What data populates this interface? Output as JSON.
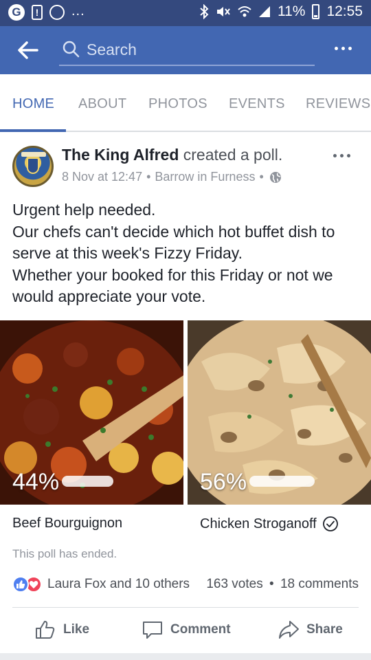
{
  "status_bar": {
    "left_icons": [
      "g-notification-icon",
      "alert-icon",
      "circle-icon",
      "more-notifications-icon"
    ],
    "more_text": "...",
    "battery": "11%",
    "time": "12:55",
    "right_icons": [
      "bluetooth-icon",
      "mute-icon",
      "wifi-icon",
      "signal-icon",
      "battery-icon"
    ]
  },
  "app_bar": {
    "search_placeholder": "Search",
    "back_icon": "back-arrow-icon",
    "more_icon": "more-horizontal-icon"
  },
  "tabs": [
    {
      "label": "HOME",
      "active": true
    },
    {
      "label": "ABOUT",
      "active": false
    },
    {
      "label": "PHOTOS",
      "active": false
    },
    {
      "label": "EVENTS",
      "active": false
    },
    {
      "label": "REVIEWS",
      "active": false
    }
  ],
  "post": {
    "author": "The King Alfred",
    "action": "created a poll.",
    "date": "8 Nov at 12:47",
    "location": "Barrow in Furness",
    "separator": "•",
    "text_lines": [
      "Urgent help needed.",
      "Our chefs can't decide which hot buffet dish to",
      "serve at this week's Fizzy Friday.",
      "Whether your booked for this Friday or not we",
      "would appreciate your vote."
    ]
  },
  "poll": {
    "options": [
      {
        "label": "Beef Bourguignon",
        "percent_text": "44%",
        "percent": 44,
        "winner": false
      },
      {
        "label": "Chicken Stroganoff",
        "percent_text": "56%",
        "percent": 56,
        "winner": true
      }
    ],
    "status": "This poll has ended."
  },
  "engagement": {
    "reactions": [
      "like-reaction-icon",
      "love-reaction-icon"
    ],
    "reactors": "Laura Fox and 10 others",
    "votes": "163 votes",
    "separator": "•",
    "comments": "18 comments"
  },
  "actions": {
    "like": "Like",
    "comment": "Comment",
    "share": "Share"
  },
  "colors": {
    "status_bar": "#34497e",
    "app_bar": "#4267b2",
    "accent": "#4267b2",
    "muted_text": "#90949c",
    "like": "#4f7ff0",
    "love": "#f0445a"
  }
}
